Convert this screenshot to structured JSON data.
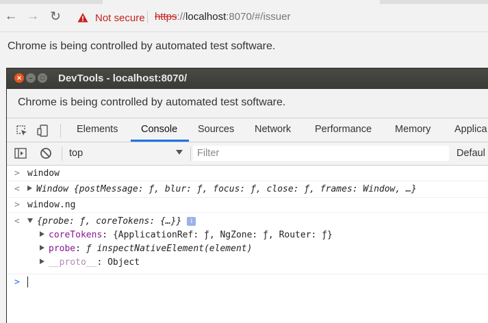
{
  "browser": {
    "security_label": "Not secure",
    "url_scheme": "https",
    "url_separator": "://",
    "url_host": "localhost",
    "url_rest": ":8070/#/issuer",
    "infobar_text": "Chrome is being controlled by automated test software."
  },
  "devtools": {
    "window_title": "DevTools - localhost:8070/",
    "infobar_text": "Chrome is being controlled by automated test software.",
    "tabs": [
      "Elements",
      "Console",
      "Sources",
      "Network",
      "Performance",
      "Memory",
      "Applica"
    ],
    "active_tab": "Console",
    "context": "top",
    "filter_placeholder": "Filter",
    "levels_label": "Defaul"
  },
  "console": {
    "entries": [
      {
        "type": "input",
        "text": "window"
      },
      {
        "type": "output",
        "text": "Window {postMessage: ƒ, blur: ƒ, focus: ƒ, close: ƒ, frames: Window, …}"
      },
      {
        "type": "input",
        "text": "window.ng"
      },
      {
        "type": "output",
        "text": "{probe: ƒ, coreTokens: {…}}"
      }
    ],
    "tree": [
      {
        "key": "coreTokens",
        "value": "{ApplicationRef: ƒ, NgZone: ƒ, Router: ƒ}"
      },
      {
        "key": "probe",
        "value": "ƒ inspectNativeElement(element)"
      },
      {
        "key": "__proto__",
        "value": "Object"
      }
    ],
    "info_badge": "i",
    "separator": ": "
  },
  "colors": {
    "accent": "#1a73e8",
    "not_secure": "#c5221f",
    "object_key": "#881391"
  }
}
